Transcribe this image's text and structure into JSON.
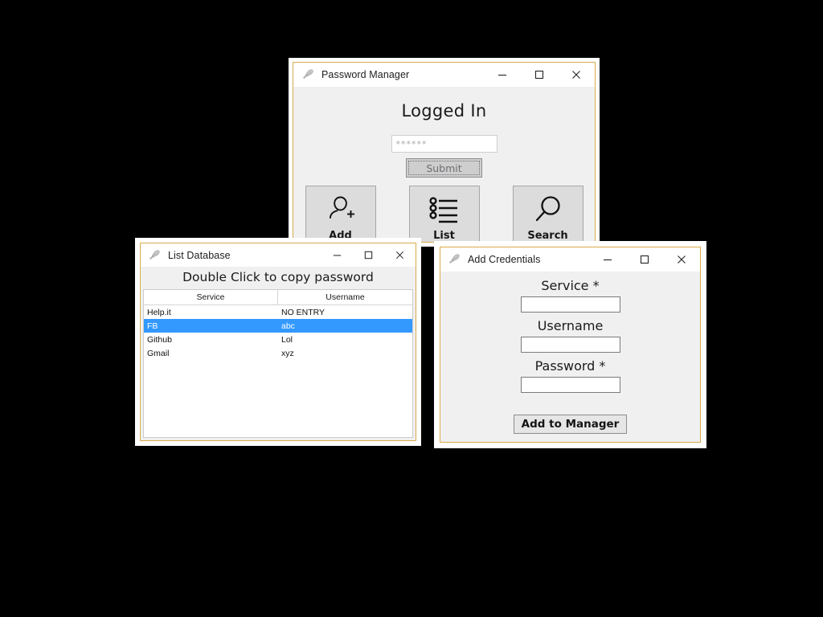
{
  "windows": {
    "main": {
      "title": "Password Manager",
      "icon": "feather-icon",
      "heading": "Logged In",
      "password_field": {
        "value": "******",
        "placeholder": ""
      },
      "submit_label": "Submit",
      "buttons": [
        {
          "label": "Add",
          "icon": "add-user-icon"
        },
        {
          "label": "List",
          "icon": "bulleted-list-icon"
        },
        {
          "label": "Search",
          "icon": "magnifier-icon"
        }
      ],
      "controls": {
        "minimize": "─",
        "maximize": "□",
        "close": "✕"
      }
    },
    "list": {
      "title": "List Database",
      "icon": "feather-icon",
      "heading": "Double Click to copy password",
      "columns": [
        "Service",
        "Username"
      ],
      "rows": [
        {
          "service": "Help.it",
          "username": "NO ENTRY",
          "selected": false
        },
        {
          "service": "FB",
          "username": "abc",
          "selected": true
        },
        {
          "service": "Github",
          "username": "Lol",
          "selected": false
        },
        {
          "service": "Gmail",
          "username": "xyz",
          "selected": false
        }
      ],
      "controls": {
        "minimize": "─",
        "maximize": "□",
        "close": "✕"
      }
    },
    "add": {
      "title": "Add Credentials",
      "icon": "feather-icon",
      "fields": [
        {
          "label": "Service *",
          "value": "",
          "placeholder": ""
        },
        {
          "label": "Username",
          "value": "",
          "placeholder": ""
        },
        {
          "label": "Password *",
          "value": "",
          "placeholder": ""
        }
      ],
      "submit_label": "Add to Manager",
      "controls": {
        "minimize": "─",
        "maximize": "□",
        "close": "✕"
      }
    }
  },
  "colors": {
    "window_border": "#d9ab49",
    "client_bg": "#f0f0f0",
    "selection_blue": "#3399ff",
    "desktop": "#000000"
  }
}
